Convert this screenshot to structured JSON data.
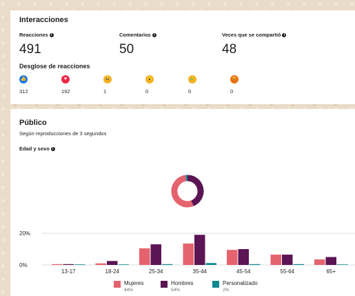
{
  "interactions": {
    "title": "Interacciones",
    "reactions_label": "Reacciones",
    "reactions_value": "491",
    "comments_label": "Comentarios",
    "comments_value": "50",
    "shares_label": "Veces que se compartió",
    "shares_value": "48",
    "breakdown_title": "Desglose de reacciones",
    "breakdown": [
      {
        "icon": "like-icon",
        "color": "#1877f2",
        "count": "312"
      },
      {
        "icon": "love-icon",
        "color": "#f02849",
        "count": "192"
      },
      {
        "icon": "haha-icon",
        "color": "#f7b125",
        "count": "1"
      },
      {
        "icon": "wow-icon",
        "color": "#f7b125",
        "count": "0"
      },
      {
        "icon": "sad-icon",
        "color": "#f7b125",
        "count": "0"
      },
      {
        "icon": "angry-icon",
        "color": "#e9710f",
        "count": "0"
      }
    ]
  },
  "audience": {
    "title": "Público",
    "subtitle": "Según reproducciones de 3 segundos",
    "section_label": "Edad y sexo"
  },
  "chart_data": {
    "type": "bar",
    "categories": [
      "13-17",
      "18-24",
      "25-34",
      "35-44",
      "45-54",
      "55-64",
      "65+"
    ],
    "yticks": [
      "20%",
      "0%"
    ],
    "ylim": [
      0,
      20
    ],
    "series": [
      {
        "name": "Mujeres",
        "share": "44%",
        "color": "#e5636e",
        "values": [
          0.1,
          1,
          10.5,
          13.5,
          9.5,
          6.5,
          3.5
        ]
      },
      {
        "name": "Hombres",
        "share": "54%",
        "color": "#5b1454",
        "values": [
          0.1,
          2.5,
          13,
          19,
          10,
          6.5,
          5
        ]
      },
      {
        "name": "Personalizado",
        "share": "2%",
        "color": "#0f8a8f",
        "values": [
          0,
          0,
          0.3,
          1.2,
          0.3,
          0.1,
          0
        ]
      }
    ],
    "donut": [
      44,
      54,
      2
    ]
  }
}
